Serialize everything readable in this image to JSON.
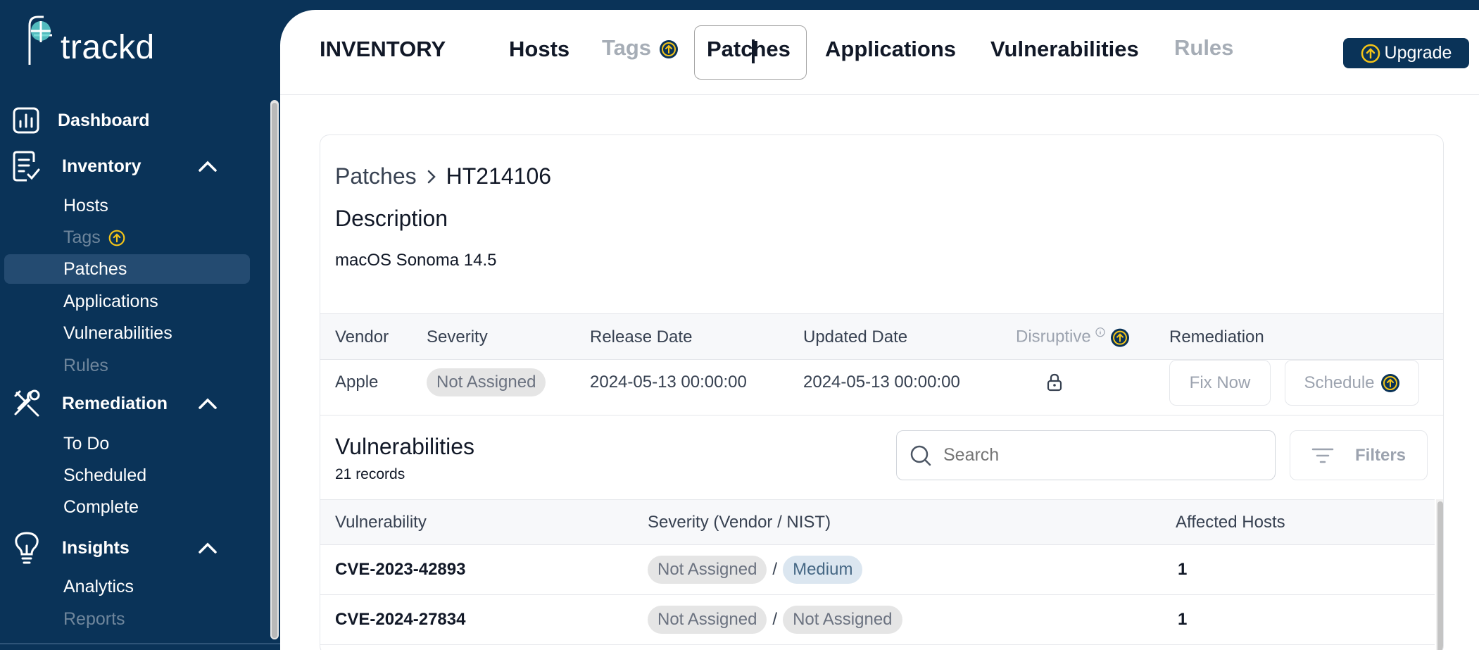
{
  "sidebar": {
    "logo_text": "trackd",
    "dashboard": "Dashboard",
    "inventory": {
      "label": "Inventory",
      "items": [
        "Hosts",
        "Tags",
        "Patches",
        "Applications",
        "Vulnerabilities",
        "Rules"
      ]
    },
    "remediation": {
      "label": "Remediation",
      "items": [
        "To Do",
        "Scheduled",
        "Complete"
      ]
    },
    "insights": {
      "label": "Insights",
      "items": [
        "Analytics",
        "Reports"
      ]
    }
  },
  "topbar": {
    "section": "INVENTORY",
    "tabs": [
      "Hosts",
      "Tags",
      "Patches",
      "Applications",
      "Vulnerabilities",
      "Rules"
    ],
    "active_tab": "Patches",
    "upgrade": "Upgrade"
  },
  "patch": {
    "breadcrumb_parent": "Patches",
    "breadcrumb_current": "HT214106",
    "description_title": "Description",
    "description": "macOS Sonoma 14.5",
    "columns": [
      "Vendor",
      "Severity",
      "Release Date",
      "Updated Date",
      "Disruptive",
      "Remediation"
    ],
    "vendor": "Apple",
    "severity": "Not Assigned",
    "release_date": "2024-05-13 00:00:00",
    "updated_date": "2024-05-13 00:00:00",
    "fix_now": "Fix Now",
    "schedule": "Schedule"
  },
  "vulnerabilities": {
    "title": "Vulnerabilities",
    "count": "21 records",
    "search_placeholder": "Search",
    "filters": "Filters",
    "columns": [
      "Vulnerability",
      "Severity (Vendor / NIST)",
      "Affected Hosts"
    ],
    "rows": [
      {
        "id": "CVE-2023-42893",
        "vendor": "Not Assigned",
        "nist": "Medium",
        "hosts": "1"
      },
      {
        "id": "CVE-2024-27834",
        "vendor": "Not Assigned",
        "nist": "Not Assigned",
        "hosts": "1"
      }
    ]
  },
  "colors": {
    "sidebar_bg": "#0a3358",
    "active_item_bg": "#244b71",
    "upgrade_badge": "#f5c518",
    "medium_pill": "#dbe6f0"
  }
}
